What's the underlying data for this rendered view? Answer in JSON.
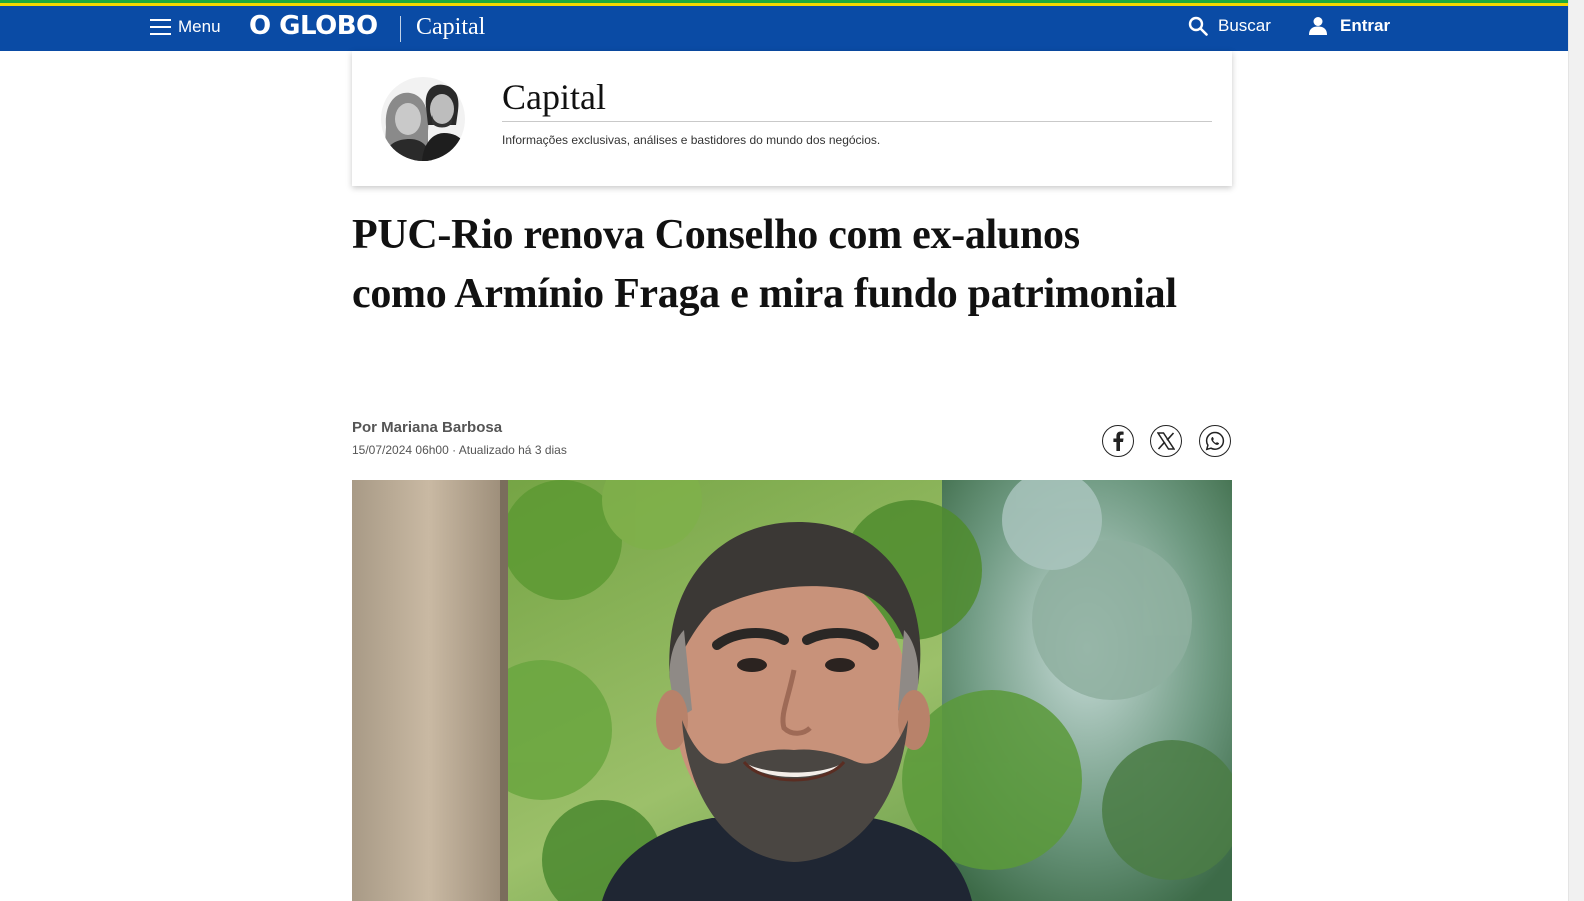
{
  "colors": {
    "nav_background": "#0a4ba5",
    "stripe_green": "#1eaa3c",
    "stripe_yellow": "#f5d800",
    "text_dark": "#111111",
    "text_muted": "#555555"
  },
  "topbar": {
    "menu_label": "Menu",
    "menu_icon": "hamburger-icon",
    "logo_text": "O GLOBO",
    "section_label": "Capital",
    "search_label": "Buscar",
    "search_icon": "search-icon",
    "login_label": "Entrar",
    "login_icon": "user-icon"
  },
  "column": {
    "title": "Capital",
    "description": "Informações exclusivas, análises e bastidores do mundo dos negócios.",
    "photo_icon": "columnists-photo"
  },
  "article": {
    "headline": "PUC-Rio renova Conselho com ex-alunos como Armínio Fraga e mira fundo patrimonial",
    "byline": "Por Mariana Barbosa",
    "dateline": "15/07/2024 06h00 · Atualizado há 3 dias"
  },
  "share": {
    "facebook_icon": "facebook-icon",
    "x_icon": "x-icon",
    "whatsapp_icon": "whatsapp-icon"
  },
  "lead_image": {
    "icon": "lead-photo"
  }
}
